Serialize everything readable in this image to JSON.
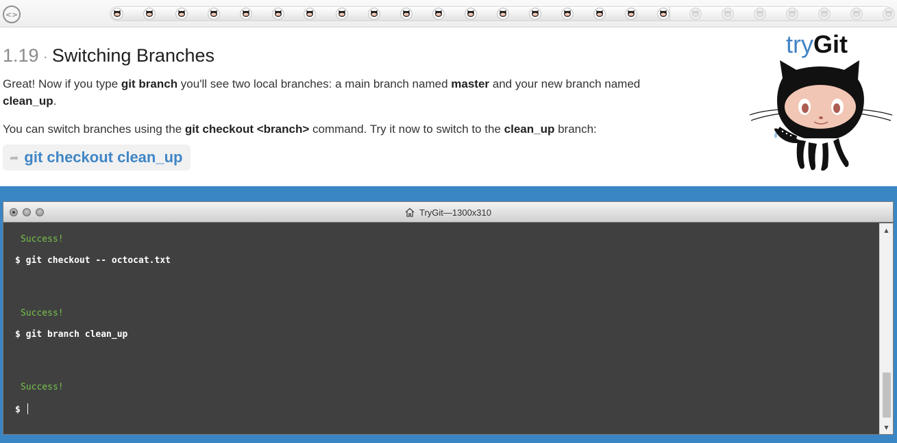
{
  "progress": {
    "toggle_label": "<>",
    "total_steps": 25,
    "completed_steps": 18,
    "step_icon": "octocat-head-icon"
  },
  "lesson": {
    "number": "1.19",
    "separator": "·",
    "title": "Switching Branches",
    "para1": {
      "t1": "Great! Now if you type ",
      "b1": "git branch",
      "t2": " you'll see two local branches: a main branch named ",
      "b2": "master",
      "t3": " and your new branch named ",
      "b3": "clean_up",
      "t4": "."
    },
    "para2": {
      "t1": "You can switch branches using the ",
      "b1": "git checkout <branch>",
      "t2": " command. Try it now to switch to the ",
      "b2": "clean_up",
      "t3": " branch:"
    },
    "command": "git checkout clean_up",
    "command_arrow": "➦"
  },
  "logo": {
    "try": "try",
    "git": "Git"
  },
  "colors": {
    "accent": "#4183c4",
    "frame": "#3a86c5",
    "terminal_bg": "#404040",
    "success": "#77c34b"
  },
  "window": {
    "title": "TryGit—1300x310",
    "home_icon": "home-icon"
  },
  "terminal": {
    "lines": [
      {
        "kind": "success",
        "text": "Success!"
      },
      {
        "kind": "prompt",
        "text": "$ git checkout -- octocat.txt"
      },
      {
        "kind": "success",
        "text": "Success!"
      },
      {
        "kind": "prompt",
        "text": "$ git branch clean_up"
      },
      {
        "kind": "success",
        "text": "Success!"
      },
      {
        "kind": "prompt",
        "text": "$ "
      }
    ]
  },
  "scrollbar": {
    "up": "▲",
    "down": "▼"
  }
}
